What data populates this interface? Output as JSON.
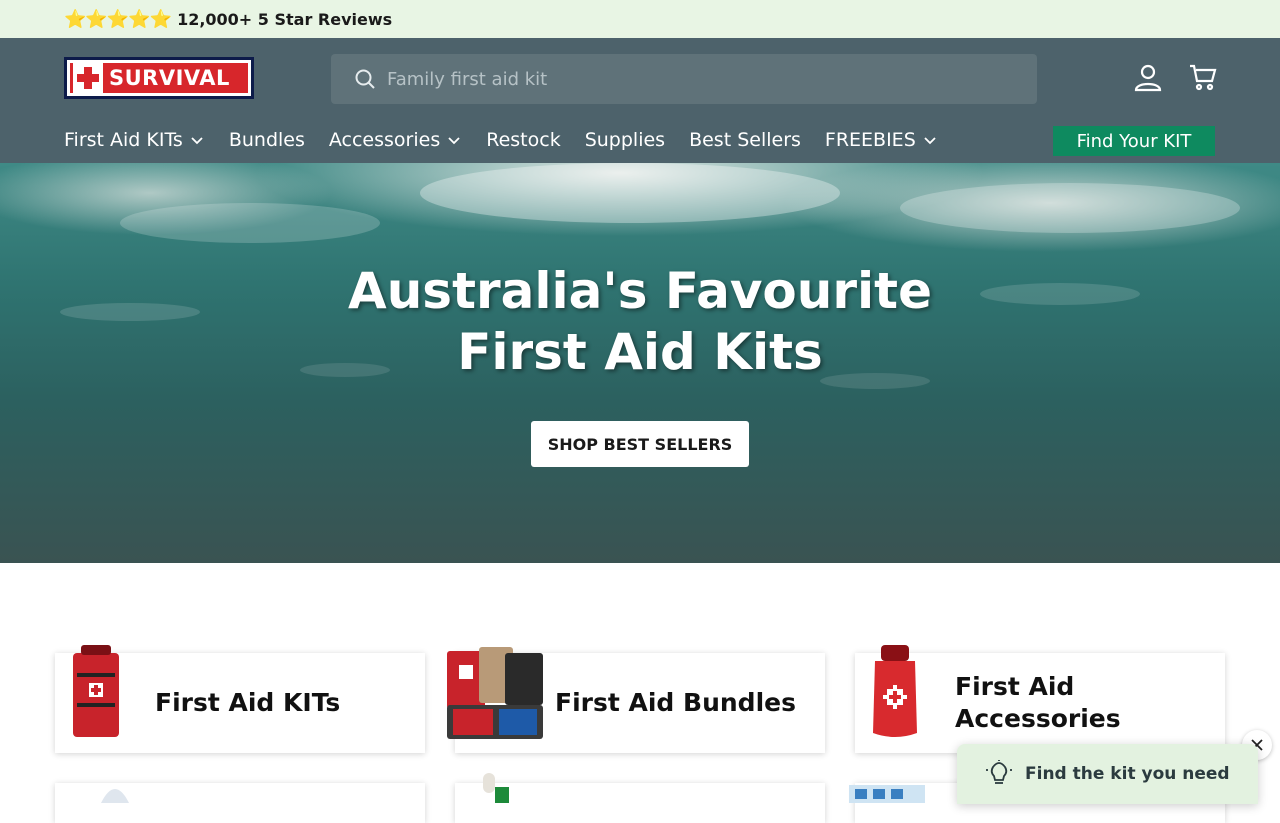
{
  "announcement": {
    "stars": "⭐⭐⭐⭐⭐",
    "text": "12,000+ 5 Star Reviews"
  },
  "header": {
    "logo_text": "SURVIVAL",
    "search": {
      "placeholder": "Family first aid kit"
    },
    "icons": [
      "account-icon",
      "cart-icon"
    ]
  },
  "nav": {
    "items": [
      {
        "label": "First Aid KITs",
        "dropdown": true
      },
      {
        "label": "Bundles",
        "dropdown": false
      },
      {
        "label": "Accessories",
        "dropdown": true
      },
      {
        "label": "Restock",
        "dropdown": false
      },
      {
        "label": "Supplies",
        "dropdown": false
      },
      {
        "label": "Best Sellers",
        "dropdown": false
      },
      {
        "label": "FREEBIES",
        "dropdown": true
      }
    ],
    "cta": "Find Your KIT"
  },
  "hero": {
    "title_line1": "Australia's Favourite",
    "title_line2": "First Aid Kits",
    "button": "SHOP BEST SELLERS"
  },
  "categories": [
    {
      "title": "First Aid KITs"
    },
    {
      "title": "First Aid Bundles"
    },
    {
      "title_line1": "First Aid",
      "title_line2": "Accessories"
    }
  ],
  "chat": {
    "label": "Find the kit you need"
  },
  "colors": {
    "announcement_bg": "#e8f5e4",
    "header_bg": "#4d626b",
    "cta_bg": "#0e8a5f",
    "brand_red": "#d7262b"
  }
}
